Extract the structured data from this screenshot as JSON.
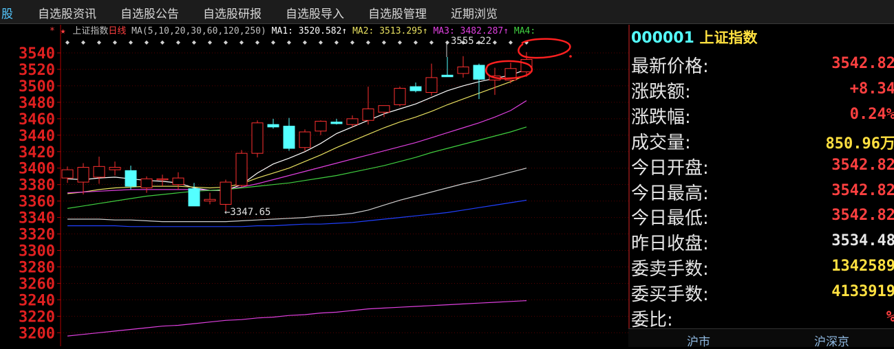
{
  "menu": {
    "items": [
      "股",
      "自选股资讯",
      "自选股公告",
      "自选股研报",
      "自选股导入",
      "自选股管理",
      "近期浏览"
    ]
  },
  "legend": {
    "marks": "* ★",
    "index_name": "上证指数",
    "period": "日线",
    "ma_params": "MA(5,10,20,30,60,120,250)",
    "ma1": "MA1: 3520.582↑",
    "ma2": "MA2: 3513.295↑",
    "ma3": "MA3: 3482.287↑",
    "ma4": "MA4:"
  },
  "chart_data": {
    "type": "candlestick",
    "y_ticks": [
      "3540",
      "3520",
      "3500",
      "3480",
      "3460",
      "3440",
      "3420",
      "3400",
      "3380",
      "3360",
      "3340",
      "3320",
      "3300",
      "3280",
      "3260",
      "3240",
      "3220",
      "3200"
    ],
    "ylim": [
      3195,
      3560
    ],
    "annotations": {
      "high": "3555.22",
      "low": "←3347.65"
    },
    "candles": [
      {
        "o": 3388,
        "h": 3402,
        "l": 3382,
        "c": 3398
      },
      {
        "o": 3383,
        "h": 3406,
        "l": 3368,
        "c": 3401
      },
      {
        "o": 3389,
        "h": 3414,
        "l": 3381,
        "c": 3402
      },
      {
        "o": 3398,
        "h": 3408,
        "l": 3391,
        "c": 3401
      },
      {
        "o": 3397,
        "h": 3403,
        "l": 3374,
        "c": 3378
      },
      {
        "o": 3376,
        "h": 3390,
        "l": 3370,
        "c": 3387
      },
      {
        "o": 3386,
        "h": 3392,
        "l": 3378,
        "c": 3387
      },
      {
        "o": 3380,
        "h": 3395,
        "l": 3374,
        "c": 3388
      },
      {
        "o": 3375,
        "h": 3382,
        "l": 3354,
        "c": 3354
      },
      {
        "o": 3360,
        "h": 3370,
        "l": 3356,
        "c": 3362
      },
      {
        "o": 3356,
        "h": 3386,
        "l": 3348,
        "c": 3383
      },
      {
        "o": 3379,
        "h": 3422,
        "l": 3377,
        "c": 3418
      },
      {
        "o": 3418,
        "h": 3458,
        "l": 3413,
        "c": 3455
      },
      {
        "o": 3453,
        "h": 3460,
        "l": 3448,
        "c": 3450
      },
      {
        "o": 3451,
        "h": 3461,
        "l": 3421,
        "c": 3424
      },
      {
        "o": 3425,
        "h": 3447,
        "l": 3421,
        "c": 3444
      },
      {
        "o": 3445,
        "h": 3458,
        "l": 3440,
        "c": 3457
      },
      {
        "o": 3456,
        "h": 3460,
        "l": 3453,
        "c": 3454
      },
      {
        "o": 3453,
        "h": 3464,
        "l": 3450,
        "c": 3460
      },
      {
        "o": 3458,
        "h": 3499,
        "l": 3453,
        "c": 3472
      },
      {
        "o": 3468,
        "h": 3476,
        "l": 3462,
        "c": 3476
      },
      {
        "o": 3477,
        "h": 3499,
        "l": 3475,
        "c": 3497
      },
      {
        "o": 3499,
        "h": 3504,
        "l": 3492,
        "c": 3494
      },
      {
        "o": 3492,
        "h": 3527,
        "l": 3488,
        "c": 3510
      },
      {
        "o": 3513,
        "h": 3535,
        "l": 3511,
        "c": 3511
      },
      {
        "o": 3515,
        "h": 3536,
        "l": 3510,
        "c": 3523
      },
      {
        "o": 3525,
        "h": 3527,
        "l": 3484,
        "c": 3508
      },
      {
        "o": 3507,
        "h": 3522,
        "l": 3489,
        "c": 3512
      },
      {
        "o": 3507,
        "h": 3528,
        "l": 3503,
        "c": 3521
      },
      {
        "o": 3517,
        "h": 3541,
        "l": 3511,
        "c": 3532
      }
    ],
    "series": [
      {
        "name": "MA1",
        "color": "#ffffff",
        "values": [
          3387,
          3386,
          3388,
          3389,
          3387,
          3385,
          3384,
          3382,
          3376,
          3373,
          3373,
          3380,
          3394,
          3405,
          3412,
          3420,
          3430,
          3442,
          3450,
          3458,
          3466,
          3472,
          3478,
          3486,
          3494,
          3500,
          3505,
          3509,
          3513,
          3520
        ]
      },
      {
        "name": "MA2",
        "color": "#e8e060",
        "values": [
          3369,
          3371,
          3374,
          3376,
          3377,
          3378,
          3378,
          3378,
          3377,
          3376,
          3377,
          3381,
          3388,
          3394,
          3400,
          3408,
          3416,
          3425,
          3433,
          3441,
          3449,
          3456,
          3462,
          3469,
          3477,
          3484,
          3491,
          3498,
          3505,
          3513
        ]
      },
      {
        "name": "MA3",
        "color": "#e040e0",
        "values": [
          3370,
          3371,
          3372,
          3373,
          3374,
          3374,
          3374,
          3374,
          3374,
          3373,
          3374,
          3377,
          3381,
          3386,
          3391,
          3396,
          3401,
          3406,
          3411,
          3416,
          3421,
          3426,
          3431,
          3437,
          3443,
          3449,
          3455,
          3462,
          3470,
          3482
        ]
      },
      {
        "name": "MA4",
        "color": "#40d040",
        "values": [
          3351,
          3354,
          3357,
          3360,
          3363,
          3366,
          3368,
          3370,
          3372,
          3373,
          3374,
          3376,
          3378,
          3380,
          3382,
          3385,
          3388,
          3391,
          3395,
          3399,
          3403,
          3408,
          3413,
          3419,
          3424,
          3429,
          3434,
          3439,
          3444,
          3450
        ]
      },
      {
        "name": "MA5",
        "color": "#d0d0d0",
        "values": [
          3338,
          3338,
          3338,
          3337,
          3337,
          3336,
          3335,
          3335,
          3335,
          3335,
          3335,
          3336,
          3337,
          3338,
          3339,
          3340,
          3342,
          3343,
          3345,
          3349,
          3355,
          3361,
          3366,
          3371,
          3376,
          3381,
          3385,
          3390,
          3395,
          3400
        ]
      },
      {
        "name": "MA6",
        "color": "#2040ff",
        "values": [
          3330,
          3330,
          3330,
          3330,
          3329,
          3329,
          3329,
          3329,
          3329,
          3329,
          3329,
          3329,
          3330,
          3330,
          3331,
          3332,
          3332,
          3333,
          3334,
          3336,
          3338,
          3340,
          3342,
          3344,
          3346,
          3349,
          3352,
          3355,
          3358,
          3361
        ]
      },
      {
        "name": "MA7",
        "color": "#e040e0",
        "values": [
          3196,
          3198,
          3200,
          3202,
          3204,
          3206,
          3208,
          3209,
          3211,
          3213,
          3215,
          3216,
          3218,
          3219,
          3221,
          3222,
          3224,
          3225,
          3227,
          3229,
          3230,
          3231,
          3232,
          3233,
          3234,
          3235,
          3236,
          3237,
          3238,
          3239
        ]
      }
    ]
  },
  "quote": {
    "code": "000001",
    "name": "上证指数",
    "rows": [
      {
        "label": "最新价格:",
        "value": "3542.82",
        "color": "#ff4040"
      },
      {
        "label": "涨跌额:",
        "value": "+8.34",
        "color": "#ff4040"
      },
      {
        "label": "涨跌幅:",
        "value": "0.24%",
        "color": "#ff4040"
      },
      {
        "label": "成交量:",
        "value": "850.96万",
        "color": "#ffe040"
      },
      {
        "label": "今日开盘:",
        "value": "3542.82",
        "color": "#ff4040"
      },
      {
        "label": "今日最高:",
        "value": "3542.82",
        "color": "#ff4040"
      },
      {
        "label": "今日最低:",
        "value": "3542.82",
        "color": "#ff4040"
      },
      {
        "label": "昨日收盘:",
        "value": "3534.48",
        "color": "#e6e6e6"
      },
      {
        "label": "委卖手数:",
        "value": "1342589",
        "color": "#ffe040"
      },
      {
        "label": "委买手数:",
        "value": "4133919",
        "color": "#ffe040"
      },
      {
        "label": "委比:",
        "value": "%",
        "color": "#ff4040"
      }
    ]
  },
  "bottom_tabs": [
    "沪市",
    "沪深京"
  ],
  "colors": {
    "up": "#ff3030",
    "down": "#54ffff",
    "axis": "#b00000",
    "code": "#54ffff",
    "name": "#ffe040"
  }
}
